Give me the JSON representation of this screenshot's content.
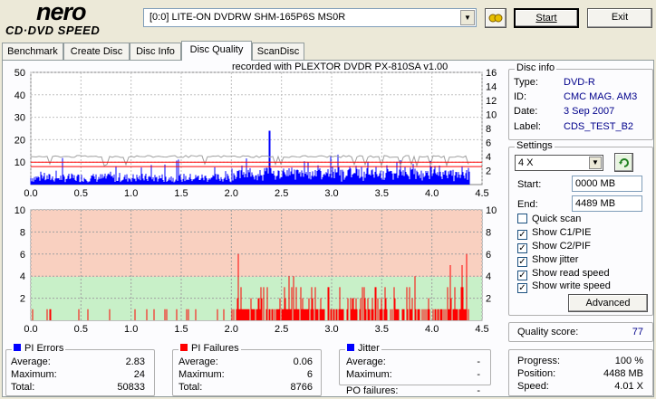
{
  "app": {
    "logo_main": "nero",
    "logo_sub": "CD·DVD SPEED"
  },
  "toolbar": {
    "drive": "[0:0]  LITE-ON DVDRW SHM-165P6S MS0R",
    "start_label": "Start",
    "exit_label": "Exit"
  },
  "tabs": [
    {
      "label": "Benchmark"
    },
    {
      "label": "Create Disc"
    },
    {
      "label": "Disc Info"
    },
    {
      "label": "Disc Quality"
    },
    {
      "label": "ScanDisc"
    }
  ],
  "recorded_with": "recorded with PLEXTOR DVDR   PX-810SA  v1.00",
  "disc_info": {
    "title": "Disc info",
    "type_label": "Type:",
    "type_value": "DVD-R",
    "id_label": "ID:",
    "id_value": "CMC MAG. AM3",
    "date_label": "Date:",
    "date_value": "3 Sep 2007",
    "label_label": "Label:",
    "label_value": "CDS_TEST_B2"
  },
  "settings": {
    "title": "Settings",
    "speed": "4 X",
    "start_label": "Start:",
    "start_value": "0000 MB",
    "end_label": "End:",
    "end_value": "4489 MB",
    "checks": [
      {
        "label": "Quick scan",
        "checked": false
      },
      {
        "label": "Show C1/PIE",
        "checked": true
      },
      {
        "label": "Show C2/PIF",
        "checked": true
      },
      {
        "label": "Show jitter",
        "checked": true
      },
      {
        "label": "Show read speed",
        "checked": true
      },
      {
        "label": "Show write speed",
        "checked": true
      }
    ],
    "advanced_label": "Advanced"
  },
  "quality": {
    "label": "Quality score:",
    "value": "77"
  },
  "progress": {
    "progress_label": "Progress:",
    "progress_value": "100 %",
    "position_label": "Position:",
    "position_value": "4488 MB",
    "speed_label": "Speed:",
    "speed_value": "4.01 X"
  },
  "pi_errors": {
    "title": "PI Errors",
    "color": "#0000ff",
    "average_label": "Average:",
    "average": "2.83",
    "maximum_label": "Maximum:",
    "maximum": "24",
    "total_label": "Total:",
    "total": "50833"
  },
  "pi_failures": {
    "title": "PI Failures",
    "color": "#ff0000",
    "average_label": "Average:",
    "average": "0.06",
    "maximum_label": "Maximum:",
    "maximum": "6",
    "total_label": "Total:",
    "total": "8766"
  },
  "jitter": {
    "title": "Jitter",
    "color": "#0000ff",
    "average_label": "Average:",
    "average": "-",
    "maximum_label": "Maximum:",
    "maximum": "-",
    "po_label": "PO failures:",
    "po_value": "-"
  },
  "chart_data": [
    {
      "type": "bar",
      "name": "PI Errors",
      "x_ticks": [
        "0.0",
        "0.5",
        "1.0",
        "1.5",
        "2.0",
        "2.5",
        "3.0",
        "3.5",
        "4.0",
        "4.5"
      ],
      "y_left_ticks": [
        "10",
        "20",
        "30",
        "40",
        "50"
      ],
      "y_right_ticks": [
        "2",
        "4",
        "6",
        "8",
        "10",
        "12",
        "14",
        "16"
      ],
      "xlim": [
        0,
        4.5
      ],
      "ylim_left": [
        0,
        50
      ],
      "ylim_right": [
        0,
        16
      ],
      "threshold_lines": [
        8,
        10
      ],
      "max_value": 24,
      "average": 2.83,
      "colors": {
        "bars": "#0000ff",
        "speed": "#a0a0a0",
        "threshold": "#ff0000"
      }
    },
    {
      "type": "bar",
      "name": "PI Failures",
      "x_ticks": [
        "0.0",
        "0.5",
        "1.0",
        "1.5",
        "2.0",
        "2.5",
        "3.0",
        "3.5",
        "4.0",
        "4.5"
      ],
      "y_left_ticks": [
        "2",
        "4",
        "6",
        "8",
        "10"
      ],
      "y_right_ticks": [
        "2",
        "4",
        "6",
        "8",
        "10"
      ],
      "xlim": [
        0,
        4.5
      ],
      "ylim": [
        0,
        10
      ],
      "max_value": 6,
      "average": 0.06,
      "colors": {
        "bars": "#ff0000",
        "bg_high": "#f9d0c0",
        "bg_low": "#c8f0c8"
      }
    }
  ]
}
